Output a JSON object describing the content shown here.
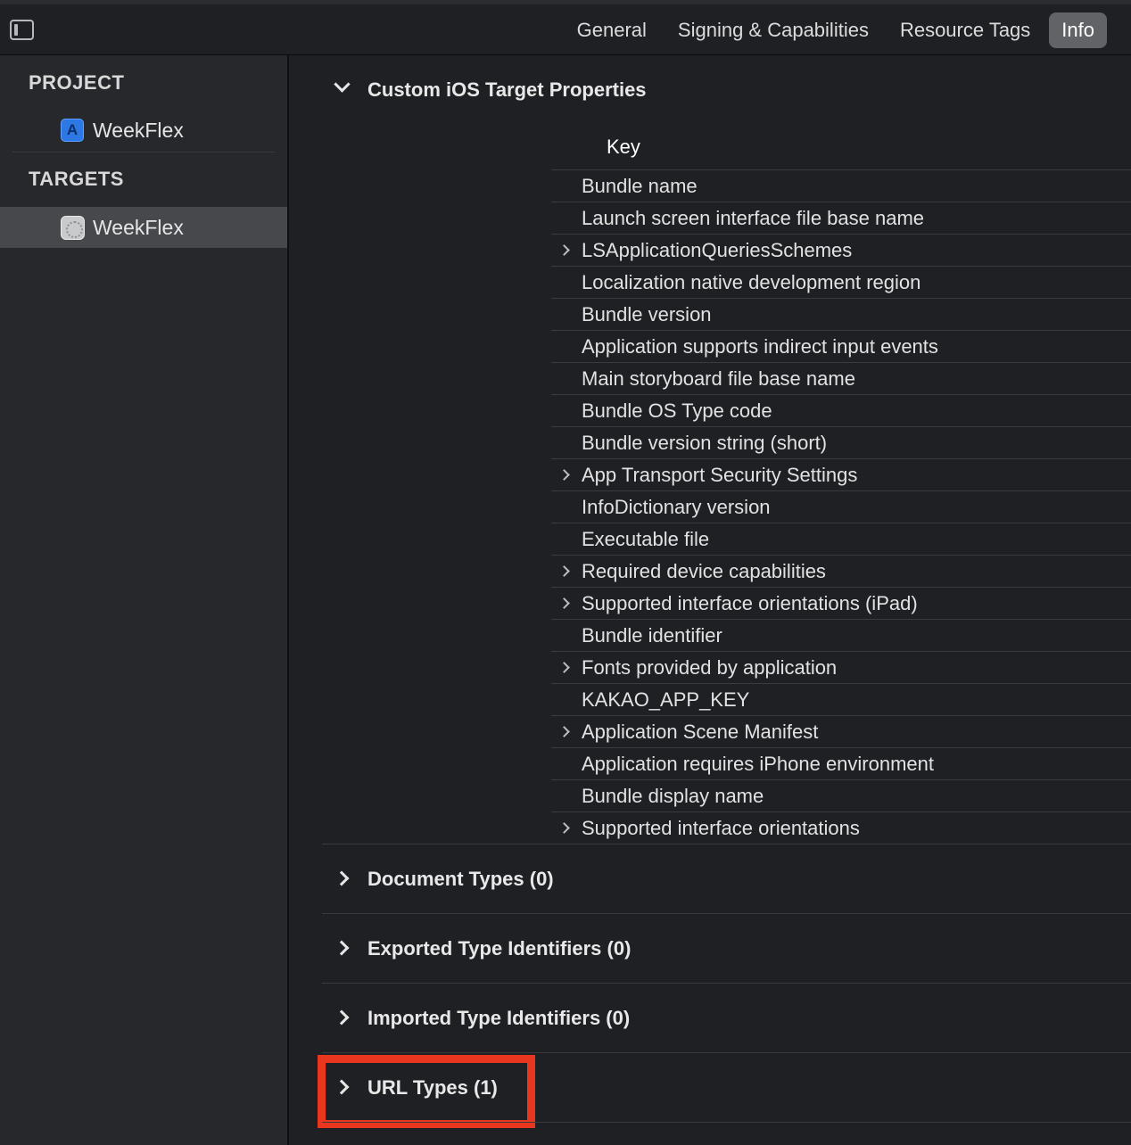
{
  "tabs": [
    "General",
    "Signing & Capabilities",
    "Resource Tags",
    "Info"
  ],
  "active_tab": "Info",
  "sidebar": {
    "project_header": "PROJECT",
    "project_item": "WeekFlex",
    "targets_header": "TARGETS",
    "target_item": "WeekFlex"
  },
  "main": {
    "custom_section_title": "Custom iOS Target Properties",
    "key_column_header": "Key",
    "keys": [
      "Bundle name",
      "Launch screen interface file base name",
      "LSApplicationQueriesSchemes",
      "Localization native development region",
      "Bundle version",
      "Application supports indirect input events",
      "Main storyboard file base name",
      "Bundle OS Type code",
      "Bundle version string (short)",
      "App Transport Security Settings",
      "InfoDictionary version",
      "Executable file",
      "Required device capabilities",
      "Supported interface orientations (iPad)",
      "Bundle identifier",
      "Fonts provided by application",
      "KAKAO_APP_KEY",
      "Application Scene Manifest",
      "Application requires iPhone environment",
      "Bundle display name",
      "Supported interface orientations"
    ],
    "document_types": "Document Types (0)",
    "exported_types": "Exported Type Identifiers (0)",
    "imported_types": "Imported Type Identifiers (0)",
    "url_types": "URL Types (1)"
  },
  "colors": {
    "highlight": "#e8361f",
    "selected_tab": "#626366"
  }
}
